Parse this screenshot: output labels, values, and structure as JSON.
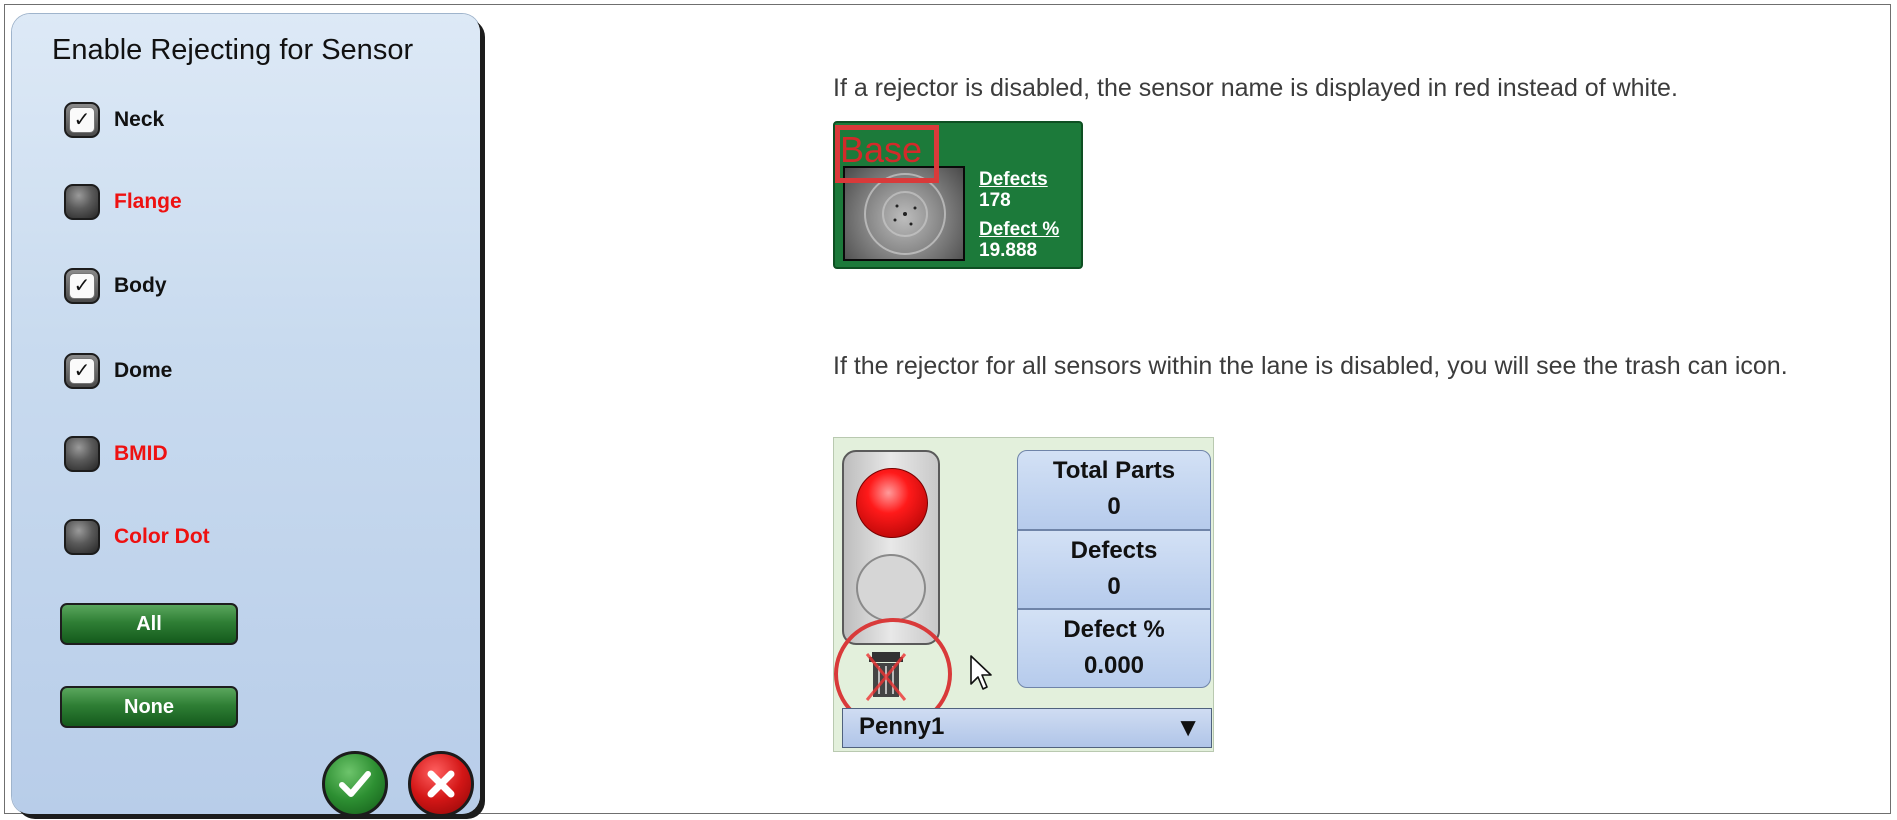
{
  "dialog": {
    "title": "Enable Rejecting for Sensor",
    "sensors": [
      {
        "label": "Neck",
        "checked": true
      },
      {
        "label": "Flange",
        "checked": false
      },
      {
        "label": "Body",
        "checked": true
      },
      {
        "label": "Dome",
        "checked": true
      },
      {
        "label": "BMID",
        "checked": false
      },
      {
        "label": "Color Dot",
        "checked": false
      }
    ],
    "all_label": "All",
    "none_label": "None",
    "ok_icon": "checkmark-icon",
    "cancel_icon": "x-icon"
  },
  "text": {
    "para1": "If a rejector is disabled, the sensor name is displayed in red instead of white.",
    "para2": "If the rejector for all sensors within the lane is disabled, you will see the trash can icon."
  },
  "sensor_tile": {
    "name": "Base",
    "defects_label": "Defects",
    "defects_value": "178",
    "defect_pct_label": "Defect %",
    "defect_pct_value": "19.888"
  },
  "lane_panel": {
    "total_parts_label": "Total Parts",
    "total_parts_value": "0",
    "defects_label": "Defects",
    "defects_value": "0",
    "defect_pct_label": "Defect %",
    "defect_pct_value": "0.000",
    "lane_name": "Penny1",
    "dropdown_arrow": "▼"
  },
  "colors": {
    "disabled_red": "#ee1111",
    "tile_green": "#1c7a3a",
    "highlight_red": "#d93a3a"
  }
}
